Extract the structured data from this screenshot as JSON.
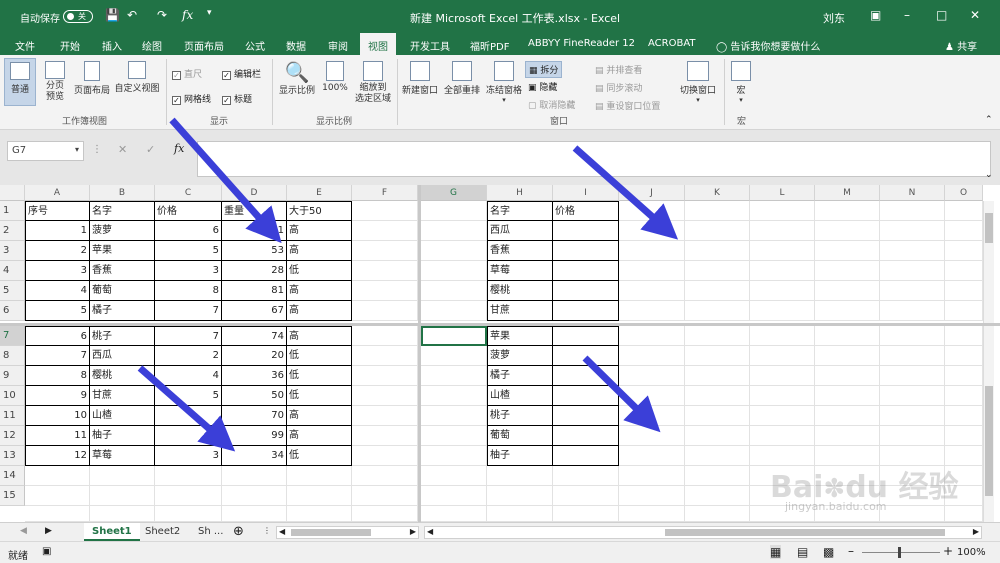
{
  "title": {
    "autosave": "自动保存",
    "autosave_state": "关",
    "doc": "新建 Microsoft Excel 工作表.xlsx - Excel",
    "user": "刘东"
  },
  "tabs": [
    "文件",
    "开始",
    "插入",
    "绘图",
    "页面布局",
    "公式",
    "数据",
    "审阅",
    "视图",
    "开发工具",
    "福昕PDF",
    "ABBYY FineReader 12",
    "ACROBAT"
  ],
  "active_tab": "视图",
  "tell_me": "告诉我你想要做什么",
  "share": "共享",
  "ribbon": {
    "normal": "普通",
    "page_break": "分页\n预览",
    "page_layout": "页面布局",
    "custom_view": "自定义视图",
    "group_workbook": "工作簿视图",
    "ruler": "直尺",
    "formula_bar": "编辑栏",
    "gridlines": "网格线",
    "headings": "标题",
    "group_show": "显示",
    "zoom": "显示比例",
    "zoom100": "100%",
    "zoom_sel": "缩放到\n选定区域",
    "group_zoom": "显示比例",
    "new_window": "新建窗口",
    "arrange_all": "全部重排",
    "freeze": "冻结窗格",
    "split": "拆分",
    "hide": "隐藏",
    "unhide": "取消隐藏",
    "side_by_side": "并排查看",
    "sync_scroll": "同步滚动",
    "reset_pos": "重设窗口位置",
    "switch_window": "切换窗口",
    "group_window": "窗口",
    "macro": "宏",
    "group_macro": "宏"
  },
  "namebox": "G7",
  "fx": "fx",
  "columns_left": [
    "A",
    "B",
    "C",
    "D",
    "E",
    "F"
  ],
  "columns_right": [
    "G",
    "H",
    "I",
    "J",
    "K",
    "L",
    "M",
    "N",
    "O"
  ],
  "rows_top": [
    "1",
    "2",
    "3",
    "4",
    "5",
    "6"
  ],
  "rows_bottom": [
    "7",
    "8",
    "9",
    "10",
    "11",
    "12",
    "13",
    "14",
    "15"
  ],
  "left_table_header": [
    "序号",
    "名字",
    "价格",
    "重量",
    "大于50"
  ],
  "left_table_top": [
    [
      "1",
      "菠萝",
      "6",
      "61",
      "高"
    ],
    [
      "2",
      "苹果",
      "5",
      "53",
      "高"
    ],
    [
      "3",
      "香蕉",
      "3",
      "28",
      "低"
    ],
    [
      "4",
      "葡萄",
      "8",
      "81",
      "高"
    ],
    [
      "5",
      "橘子",
      "7",
      "67",
      "高"
    ]
  ],
  "left_table_bottom": [
    [
      "6",
      "桃子",
      "7",
      "74",
      "高"
    ],
    [
      "7",
      "西瓜",
      "2",
      "20",
      "低"
    ],
    [
      "8",
      "樱桃",
      "4",
      "36",
      "低"
    ],
    [
      "9",
      "甘蔗",
      "5",
      "50",
      "低"
    ],
    [
      "10",
      "山楂",
      "",
      "70",
      "高"
    ],
    [
      "11",
      "柚子",
      "",
      "99",
      "高"
    ],
    [
      "12",
      "草莓",
      "3",
      "34",
      "低"
    ]
  ],
  "right_table_header": [
    "名字",
    "价格"
  ],
  "right_table_top": [
    "西瓜",
    "香蕉",
    "草莓",
    "樱桃",
    "甘蔗"
  ],
  "right_table_bottom": [
    "苹果",
    "菠萝",
    "橘子",
    "山楂",
    "桃子",
    "葡萄",
    "柚子"
  ],
  "sheets": [
    "Sheet1",
    "Sheet2",
    "Sh ..."
  ],
  "status": {
    "ready": "就绪",
    "zoom": "100%"
  },
  "watermark": {
    "logo": "Bai du 经验",
    "url": "jingyan.baidu.com"
  },
  "colors": {
    "excel_green": "#217346",
    "arrow": "#3b3fd8"
  }
}
